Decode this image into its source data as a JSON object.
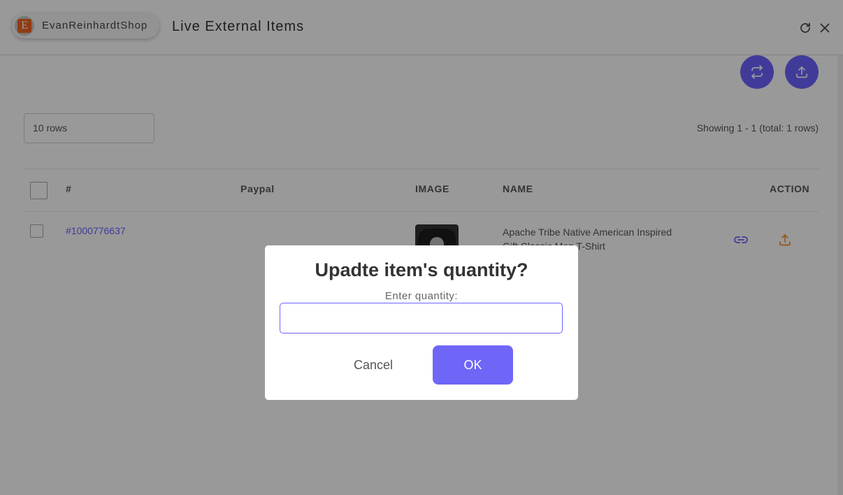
{
  "header": {
    "shop_name": "EvanReinhardtShop",
    "shop_logo_letter": "E",
    "title": "Live External Items",
    "icons": [
      "refresh-icon",
      "close-icon"
    ]
  },
  "actions": {
    "icons": [
      "sync-icon",
      "upload-icon"
    ]
  },
  "controls": {
    "rows_select": "10 rows",
    "showing_text": "Showing 1 - 1 (total: 1 rows)"
  },
  "table": {
    "columns": [
      "#",
      "Paypal",
      "IMAGE",
      "NAME",
      "ACTION"
    ],
    "rows": [
      {
        "id": "#1000776637",
        "paypal": "",
        "name": "Apache Tribe Native American Inspired Gift Classic Men T-Shirt",
        "action_icons": [
          "link-icon",
          "upload-icon"
        ]
      }
    ]
  },
  "dialog": {
    "title": "Upadte item's quantity?",
    "label": "Enter quantity:",
    "input_value": "",
    "cancel_label": "Cancel",
    "ok_label": "OK"
  },
  "colors": {
    "accent": "#6c63ff",
    "export_icon": "#f0932b",
    "overlay": "rgba(0,0,0,0.4)"
  }
}
